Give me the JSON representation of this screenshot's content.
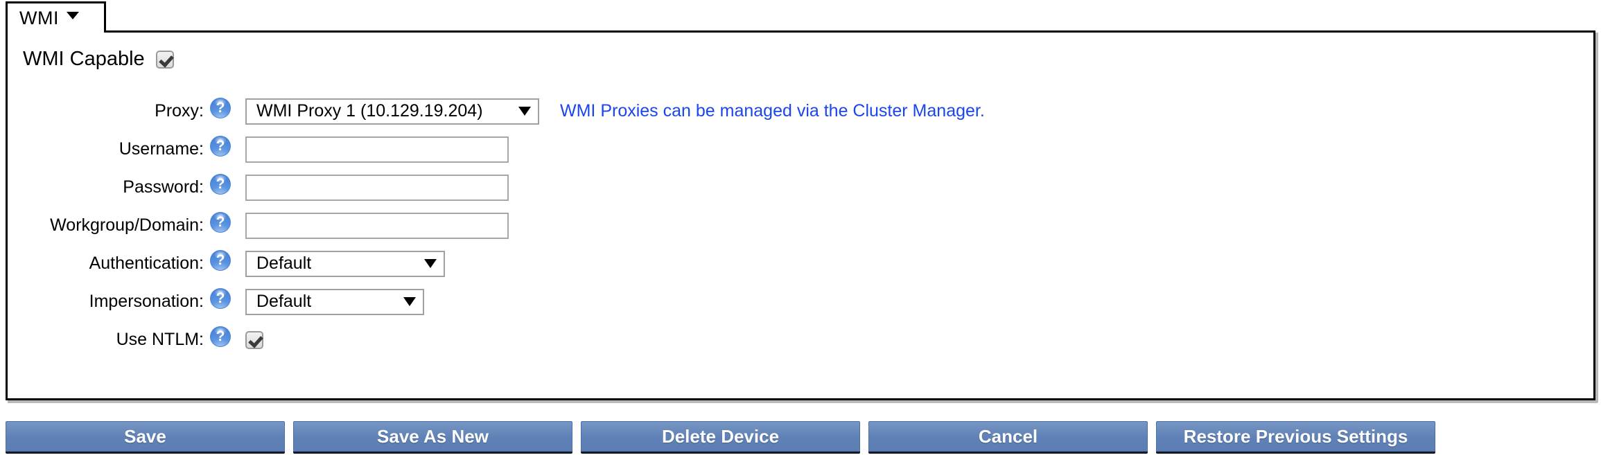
{
  "tab": {
    "label": "WMI",
    "caret_icon": "chevron-down-icon"
  },
  "panel": {
    "capable": {
      "label": "WMI Capable",
      "checked": "true"
    },
    "rows": [
      {
        "label": "Proxy:",
        "help_icon": "help-question-icon",
        "control": "select",
        "value": "WMI Proxy 1 (10.129.19.204)",
        "note": "WMI Proxies can be managed via the Cluster Manager."
      },
      {
        "label": "Username:",
        "help_icon": "help-question-icon",
        "control": "text",
        "value": "",
        "placeholder": ""
      },
      {
        "label": "Password:",
        "help_icon": "help-question-icon",
        "control": "text",
        "value": "",
        "placeholder": ""
      },
      {
        "label": "Workgroup/Domain:",
        "help_icon": "help-question-icon",
        "control": "text",
        "value": "",
        "placeholder": ""
      },
      {
        "label": "Authentication:",
        "help_icon": "help-question-icon",
        "control": "select",
        "value": "Default"
      },
      {
        "label": "Impersonation:",
        "help_icon": "help-question-icon",
        "control": "select",
        "value": "Default"
      },
      {
        "label": "Use NTLM:",
        "help_icon": "help-question-icon",
        "control": "checkbox",
        "checked": "true"
      }
    ]
  },
  "buttons": [
    {
      "label": "Save"
    },
    {
      "label": "Save As New"
    },
    {
      "label": "Delete Device"
    },
    {
      "label": "Cancel"
    },
    {
      "label": "Restore Previous Settings"
    }
  ],
  "colors": {
    "link": "#1a46ec",
    "button_blue": "#5f81b6",
    "border_black": "#000000",
    "help_icon_blue": "#4a85d8"
  }
}
